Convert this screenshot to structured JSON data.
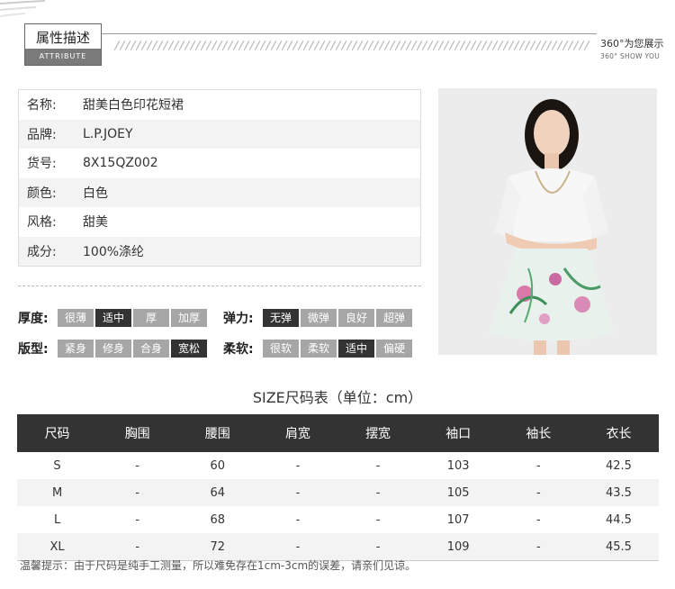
{
  "header": {
    "title_cn": "属性描述",
    "title_en": "ATTRIBUTE",
    "right_line1": "360°为您展示",
    "right_line2": "360° SHOW YOU"
  },
  "info": [
    {
      "key": "名称:",
      "value": "甜美白色印花短裙"
    },
    {
      "key": "品牌:",
      "value": "L.P.JOEY"
    },
    {
      "key": "货号:",
      "value": "8X15QZ002"
    },
    {
      "key": "颜色:",
      "value": "白色"
    },
    {
      "key": "风格:",
      "value": "甜美"
    },
    {
      "key": "成分:",
      "value": "100%涤纶"
    }
  ],
  "attributes": [
    {
      "label": "厚度:",
      "options": [
        "很薄",
        "适中",
        "厚",
        "加厚"
      ],
      "selected": 1
    },
    {
      "label": "弹力:",
      "options": [
        "无弹",
        "微弹",
        "良好",
        "超弹"
      ],
      "selected": 0
    },
    {
      "label": "版型:",
      "options": [
        "紧身",
        "修身",
        "合身",
        "宽松"
      ],
      "selected": 3
    },
    {
      "label": "柔软:",
      "options": [
        "很软",
        "柔软",
        "适中",
        "偏硬"
      ],
      "selected": 2
    }
  ],
  "size_title": "SIZE尺码表（单位：cm）",
  "size_table": {
    "headers": [
      "尺码",
      "胸围",
      "腰围",
      "肩宽",
      "摆宽",
      "袖口",
      "袖长",
      "衣长"
    ],
    "rows": [
      [
        "S",
        "-",
        "60",
        "-",
        "-",
        "103",
        "-",
        "42.5"
      ],
      [
        "M",
        "-",
        "64",
        "-",
        "-",
        "105",
        "-",
        "43.5"
      ],
      [
        "L",
        "-",
        "68",
        "-",
        "-",
        "107",
        "-",
        "44.5"
      ],
      [
        "XL",
        "-",
        "72",
        "-",
        "-",
        "109",
        "-",
        "45.5"
      ]
    ]
  },
  "note": "温馨提示：由于尺码是纯手工测量，所以难免存在1cm-3cm的误差，请亲们见谅。",
  "colors": {
    "dark": "#333333",
    "pill_gray": "#a6a6a6",
    "row_alt": "#f3f3f3"
  }
}
